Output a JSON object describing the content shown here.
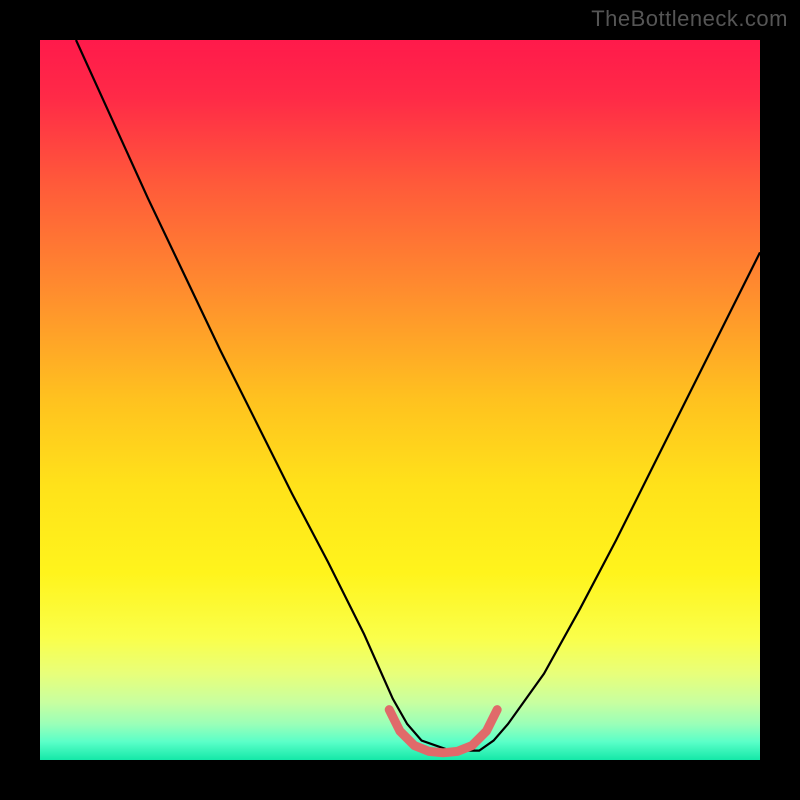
{
  "watermark": "TheBottleneck.com",
  "chart_data": {
    "type": "line",
    "title": "",
    "xlabel": "",
    "ylabel": "",
    "xlim": [
      0,
      100
    ],
    "ylim": [
      0,
      100
    ],
    "grid": false,
    "legend": false,
    "background": {
      "type": "vertical-gradient",
      "stops": [
        {
          "pos": 0.0,
          "color": "#ff1a4b"
        },
        {
          "pos": 0.08,
          "color": "#ff2a47"
        },
        {
          "pos": 0.2,
          "color": "#ff5a3a"
        },
        {
          "pos": 0.35,
          "color": "#ff8d2e"
        },
        {
          "pos": 0.5,
          "color": "#ffc21f"
        },
        {
          "pos": 0.62,
          "color": "#ffe21a"
        },
        {
          "pos": 0.74,
          "color": "#fff41c"
        },
        {
          "pos": 0.83,
          "color": "#faff4a"
        },
        {
          "pos": 0.88,
          "color": "#e8ff7a"
        },
        {
          "pos": 0.92,
          "color": "#c8ffa0"
        },
        {
          "pos": 0.95,
          "color": "#9affb8"
        },
        {
          "pos": 0.975,
          "color": "#5affc8"
        },
        {
          "pos": 1.0,
          "color": "#14e8a8"
        }
      ]
    },
    "series": [
      {
        "name": "bottleneck-curve",
        "color": "#000000",
        "width": 2.2,
        "x": [
          5,
          10,
          15,
          20,
          25,
          30,
          35,
          40,
          45,
          49,
          51,
          53,
          57,
          61,
          63,
          65,
          70,
          75,
          80,
          85,
          90,
          95,
          100
        ],
        "y": [
          100,
          89,
          78,
          67.5,
          57,
          47,
          37,
          27.5,
          17.5,
          8.5,
          5,
          2.7,
          1.3,
          1.3,
          2.7,
          5,
          12,
          21,
          30.5,
          40.5,
          50.5,
          60.5,
          70.5
        ]
      },
      {
        "name": "optimal-zone-marker",
        "color": "#e06a6a",
        "width": 9,
        "linecap": "round",
        "x": [
          48.5,
          50,
          52,
          54,
          56,
          58,
          60,
          62,
          63.5
        ],
        "y": [
          7.0,
          4.0,
          2.0,
          1.2,
          1.0,
          1.2,
          2.0,
          4.0,
          7.0
        ]
      }
    ]
  }
}
